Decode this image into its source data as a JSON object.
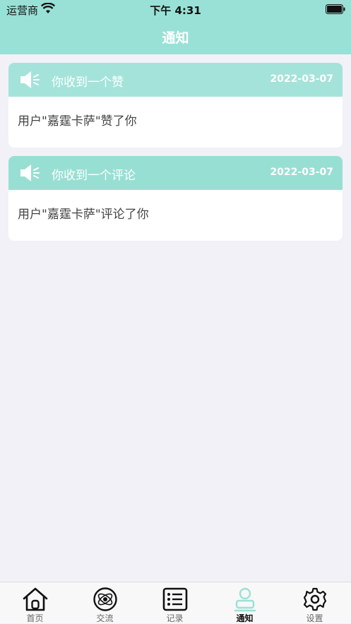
{
  "status": {
    "carrier": "运营商",
    "time": "下午 4:31"
  },
  "nav": {
    "title": "通知"
  },
  "notifications": [
    {
      "title": "你收到一个赞",
      "date": "2022-03-07",
      "body": "用户\"嘉霆卡萨\"赞了你"
    },
    {
      "title": "你收到一个评论",
      "date": "2022-03-07",
      "body": "用户\"嘉霆卡萨\"评论了你"
    }
  ],
  "tabs": [
    {
      "label": "首页",
      "icon": "home-icon"
    },
    {
      "label": "交流",
      "icon": "planet-icon"
    },
    {
      "label": "记录",
      "icon": "list-icon"
    },
    {
      "label": "通知",
      "icon": "user-icon",
      "active": true
    },
    {
      "label": "设置",
      "icon": "gear-icon"
    }
  ],
  "colors": {
    "accent": "#99e1d6",
    "background": "#f2f1f7"
  }
}
